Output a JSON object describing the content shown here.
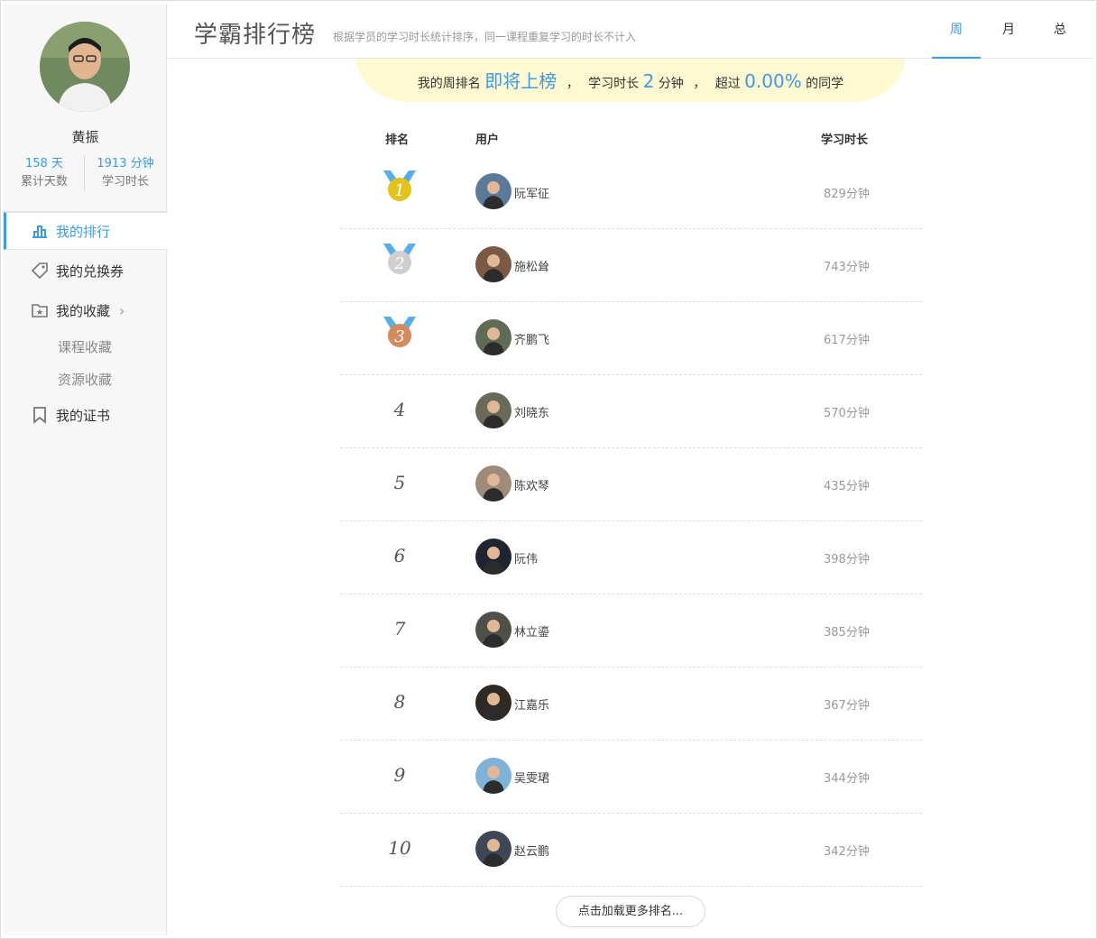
{
  "profile": {
    "name": "黄振",
    "days_value": "158 天",
    "days_label": "累计天数",
    "minutes_value": "1913 分钟",
    "minutes_label": "学习时长"
  },
  "sidebar": {
    "items": [
      {
        "label": "我的排行",
        "icon": "ranking-icon",
        "active": true
      },
      {
        "label": "我的兑换券",
        "icon": "coupon-tag-icon"
      },
      {
        "label": "我的收藏",
        "icon": "favorites-folder-icon"
      },
      {
        "label": "课程收藏"
      },
      {
        "label": "资源收藏"
      },
      {
        "label": "我的证书",
        "icon": "certificate-bookmark-icon"
      }
    ]
  },
  "header": {
    "title": "学霸排行榜",
    "description": "根据学员的学习时长统计排序，同一课程重复学习的时长不计入",
    "tabs": [
      {
        "label": "周",
        "active": true
      },
      {
        "label": "月"
      },
      {
        "label": "总"
      }
    ]
  },
  "banner": {
    "prefix": "我的周排名",
    "rank_status": "即将上榜",
    "comma1": "，",
    "time_prefix": "学习时长",
    "time_value": "2",
    "time_unit": "分钟",
    "comma2": "，",
    "exceed_prefix": "超过",
    "exceed_value": "0.00%",
    "exceed_suffix": "的同学"
  },
  "table": {
    "headers": {
      "rank": "排名",
      "user": "用户",
      "time": "学习时长"
    },
    "rows": [
      {
        "rank": "1",
        "name": "阮军征",
        "time": "829分钟",
        "avatar_color": "#5b7a99"
      },
      {
        "rank": "2",
        "name": "施松耸",
        "time": "743分钟",
        "avatar_color": "#7a5a44"
      },
      {
        "rank": "3",
        "name": "齐鹏飞",
        "time": "617分钟",
        "avatar_color": "#5f6b55"
      },
      {
        "rank": "4",
        "name": "刘晓东",
        "time": "570分钟",
        "avatar_color": "#6a6a5a"
      },
      {
        "rank": "5",
        "name": "陈欢琴",
        "time": "435分钟",
        "avatar_color": "#a08b7a"
      },
      {
        "rank": "6",
        "name": "阮伟",
        "time": "398分钟",
        "avatar_color": "#1f2530"
      },
      {
        "rank": "7",
        "name": "林立鎏",
        "time": "385分钟",
        "avatar_color": "#4d5148"
      },
      {
        "rank": "8",
        "name": "江嘉乐",
        "time": "367分钟",
        "avatar_color": "#2f2a24"
      },
      {
        "rank": "9",
        "name": "吴雯珺",
        "time": "344分钟",
        "avatar_color": "#7fb2d9"
      },
      {
        "rank": "10",
        "name": "赵云鹏",
        "time": "342分钟",
        "avatar_color": "#3d4756"
      }
    ]
  },
  "load_more": "点击加载更多排名...",
  "colors": {
    "accent": "#3d9ae8",
    "banner_bg": "#fff9d2",
    "gold": "#e3c21a",
    "silver": "#cfcfcf",
    "bronze": "#d58a5e",
    "ribbon": "#5aaee8"
  }
}
